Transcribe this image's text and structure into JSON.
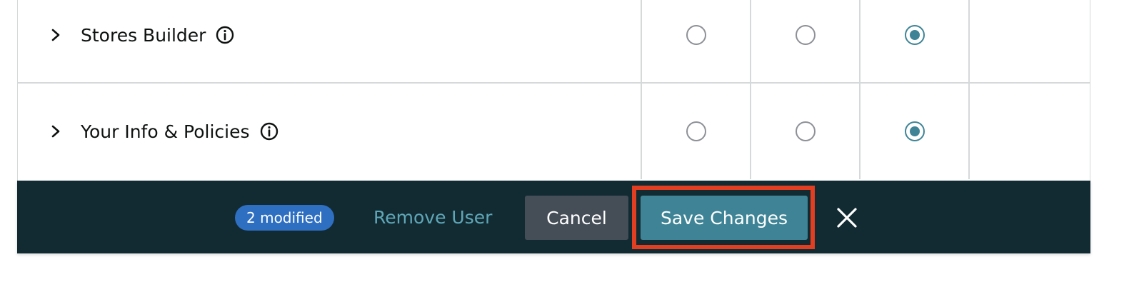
{
  "permissions": {
    "rows": [
      {
        "label": "Stores Builder",
        "radios": [
          false,
          false,
          true
        ]
      },
      {
        "label": "Your Info & Policies",
        "radios": [
          false,
          false,
          true
        ]
      }
    ]
  },
  "action_bar": {
    "modified_badge": "2 modified",
    "remove_user_label": "Remove User",
    "cancel_label": "Cancel",
    "save_label": "Save Changes"
  },
  "icons": {
    "expand": "chevron-right-icon",
    "info": "info-icon",
    "close": "close-icon"
  },
  "colors": {
    "accent": "#3e8496",
    "action_bar_bg": "#122b33",
    "badge_bg": "#2f6fc2",
    "highlight": "#e23f22",
    "link": "#5fa7b7"
  }
}
